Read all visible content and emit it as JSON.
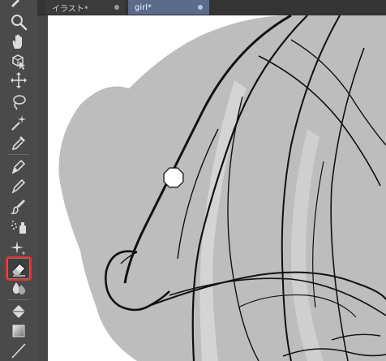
{
  "tabs": [
    {
      "label": "イラスト*",
      "active": false
    },
    {
      "label": "girl*",
      "active": true
    }
  ],
  "toolbar": {
    "tools": [
      {
        "name": "zoom",
        "icon": "magnifier-icon",
        "active": false
      },
      {
        "name": "move-view",
        "icon": "hand-icon",
        "active": false
      },
      {
        "name": "operation",
        "icon": "cube-arrow-icon",
        "active": false
      },
      {
        "name": "move-layer",
        "icon": "move-arrows-icon",
        "active": false
      },
      {
        "name": "lasso-selection",
        "icon": "lasso-icon",
        "active": false
      },
      {
        "name": "auto-select",
        "icon": "magic-wand-icon",
        "active": false
      },
      {
        "name": "eyedropper",
        "icon": "eyedropper-icon",
        "active": false
      },
      {
        "name": "pen",
        "icon": "pen-icon",
        "active": false
      },
      {
        "name": "pencil",
        "icon": "pencil-icon",
        "active": false
      },
      {
        "name": "brush",
        "icon": "brush-icon",
        "active": false
      },
      {
        "name": "airbrush",
        "icon": "airbrush-icon",
        "active": false
      },
      {
        "name": "decoration",
        "icon": "sparkle-icon",
        "active": false
      },
      {
        "name": "eraser",
        "icon": "eraser-icon",
        "active": true
      },
      {
        "name": "blend",
        "icon": "blend-drops-icon",
        "active": false
      },
      {
        "name": "fill",
        "icon": "fill-bucket-icon",
        "active": false
      },
      {
        "name": "gradient",
        "icon": "gradient-icon",
        "active": false
      },
      {
        "name": "line",
        "icon": "line-icon",
        "active": false
      }
    ]
  },
  "colors": {
    "active_outline": "#e23232",
    "active_tab": "#5b6b8a",
    "canvas": "#ffffff",
    "hair_fill": "#bfbfbf",
    "line_art": "#111111"
  }
}
